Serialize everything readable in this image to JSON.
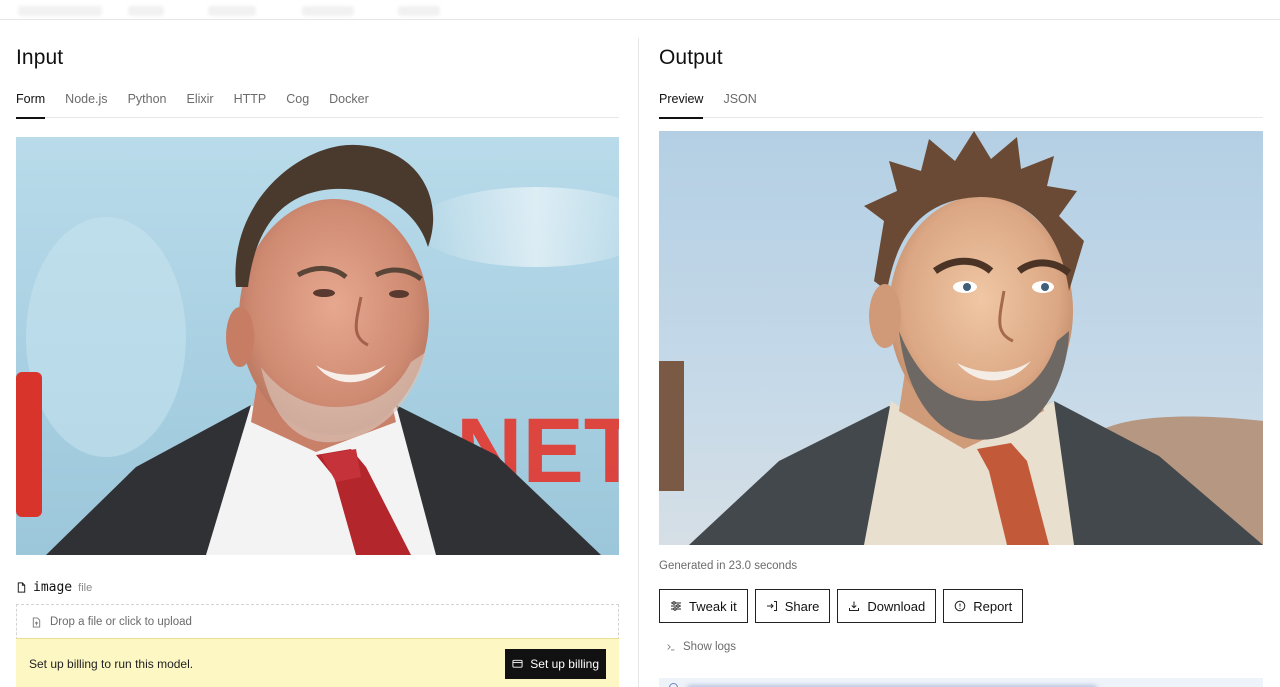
{
  "input": {
    "title": "Input",
    "tabs": [
      {
        "label": "Form",
        "active": true
      },
      {
        "label": "Node.js"
      },
      {
        "label": "Python"
      },
      {
        "label": "Elixir"
      },
      {
        "label": "HTTP"
      },
      {
        "label": "Cog"
      },
      {
        "label": "Docker"
      }
    ],
    "field": {
      "name": "image",
      "type": "file"
    },
    "dropzone": "Drop a file or click to upload",
    "billing": {
      "message": "Set up billing to run this model.",
      "button": "Set up billing"
    },
    "backdrop_text": "NETF"
  },
  "output": {
    "title": "Output",
    "tabs": [
      {
        "label": "Preview",
        "active": true
      },
      {
        "label": "JSON"
      }
    ],
    "generated": "Generated in 23.0 seconds",
    "actions": [
      "Tweak it",
      "Share",
      "Download",
      "Report"
    ],
    "show_logs": "Show logs"
  },
  "colors": {
    "billing_bg": "#fdf7c3",
    "accent": "#111111",
    "netflix_red": "#e50914"
  }
}
